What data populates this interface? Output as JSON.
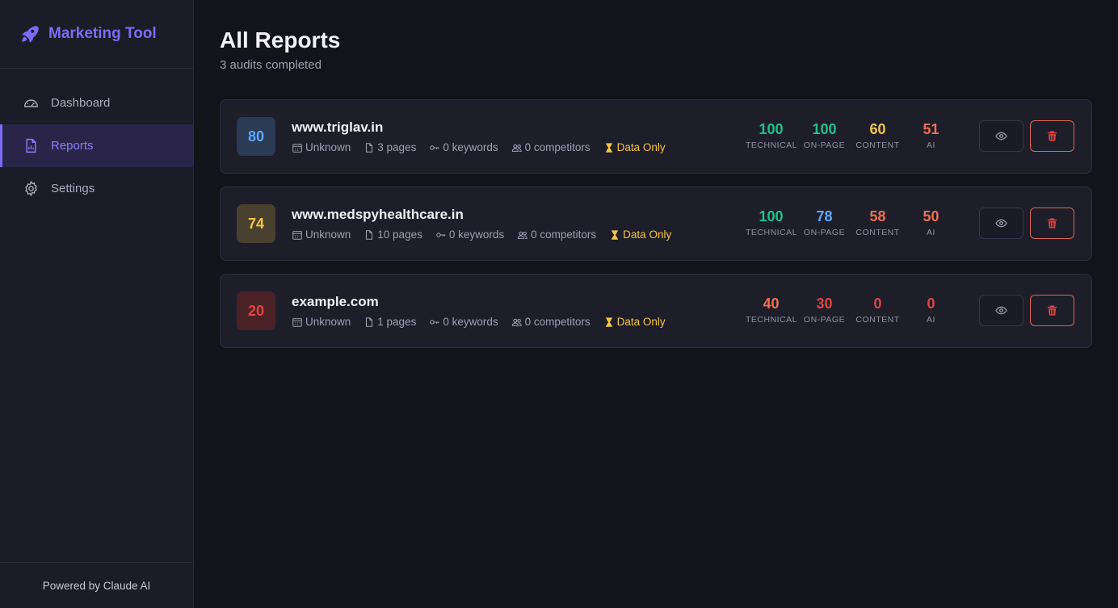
{
  "app": {
    "name": "Marketing Tool",
    "footer": "Powered by Claude AI"
  },
  "nav": [
    {
      "label": "Dashboard",
      "icon": "gauge-icon",
      "active": false
    },
    {
      "label": "Reports",
      "icon": "report-icon",
      "active": true
    },
    {
      "label": "Settings",
      "icon": "gear-icon",
      "active": false
    }
  ],
  "page": {
    "title": "All Reports",
    "subtitle": "3 audits completed"
  },
  "colors": {
    "accent": "#7c6cf5",
    "green": "#22c08a",
    "blue": "#5ea8ff",
    "yellow": "#f5c542",
    "orange": "#ef6f52",
    "red": "#e0453f"
  },
  "score_labels": [
    "TECHNICAL",
    "ON-PAGE",
    "CONTENT",
    "AI"
  ],
  "reports": [
    {
      "score": "80",
      "score_color": "#5ea8ff",
      "score_bg": "#2b3a55",
      "site": "www.triglav.in",
      "date": "Unknown",
      "pages": "3 pages",
      "keywords": "0 keywords",
      "competitors": "0 competitors",
      "status": "Data Only",
      "scores": [
        {
          "value": "100",
          "color": "#22c08a"
        },
        {
          "value": "100",
          "color": "#22c08a"
        },
        {
          "value": "60",
          "color": "#f5c542"
        },
        {
          "value": "51",
          "color": "#ef6f52"
        }
      ]
    },
    {
      "score": "74",
      "score_color": "#f5c542",
      "score_bg": "#4a4030",
      "site": "www.medspyhealthcare.in",
      "date": "Unknown",
      "pages": "10 pages",
      "keywords": "0 keywords",
      "competitors": "0 competitors",
      "status": "Data Only",
      "scores": [
        {
          "value": "100",
          "color": "#22c08a"
        },
        {
          "value": "78",
          "color": "#5ea8ff"
        },
        {
          "value": "58",
          "color": "#ef6f52"
        },
        {
          "value": "50",
          "color": "#ef6f52"
        }
      ]
    },
    {
      "score": "20",
      "score_color": "#e0453f",
      "score_bg": "#4a2226",
      "site": "example.com",
      "date": "Unknown",
      "pages": "1 pages",
      "keywords": "0 keywords",
      "competitors": "0 competitors",
      "status": "Data Only",
      "scores": [
        {
          "value": "40",
          "color": "#ef6f52"
        },
        {
          "value": "30",
          "color": "#e0453f"
        },
        {
          "value": "0",
          "color": "#e0453f"
        },
        {
          "value": "0",
          "color": "#e0453f"
        }
      ]
    }
  ]
}
